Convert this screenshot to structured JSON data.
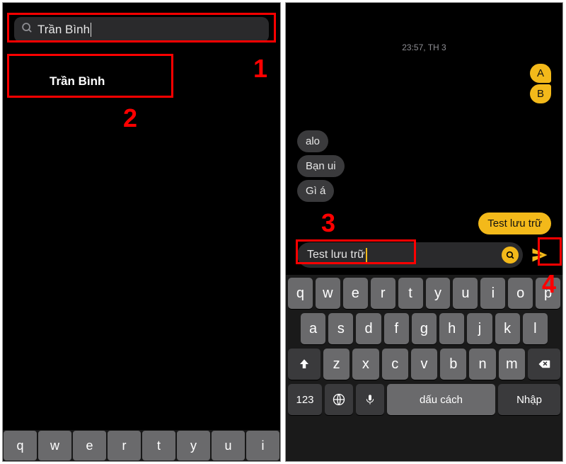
{
  "left": {
    "search_value": "Trần Bình",
    "result_name": "Trần Bình",
    "kb_row": [
      "q",
      "w",
      "e",
      "r",
      "t",
      "y",
      "u",
      "i"
    ]
  },
  "right": {
    "timestamp": "23:57, TH 3",
    "sent": [
      "A",
      "B"
    ],
    "received": [
      "alo",
      "Bạn ui",
      "Gì á"
    ],
    "last_sent": "Test lưu trữ",
    "compose_value": "Test lưu trữ",
    "keyboard": {
      "r1": [
        "q",
        "w",
        "e",
        "r",
        "t",
        "y",
        "u",
        "i",
        "o",
        "p"
      ],
      "r2": [
        "a",
        "s",
        "d",
        "f",
        "g",
        "h",
        "j",
        "k",
        "l"
      ],
      "r3": [
        "z",
        "x",
        "c",
        "v",
        "b",
        "n",
        "m"
      ],
      "num_label": "123",
      "space_label": "dấu cách",
      "return_label": "Nhập"
    }
  },
  "annotations": {
    "n1": "1",
    "n2": "2",
    "n3": "3",
    "n4": "4"
  }
}
